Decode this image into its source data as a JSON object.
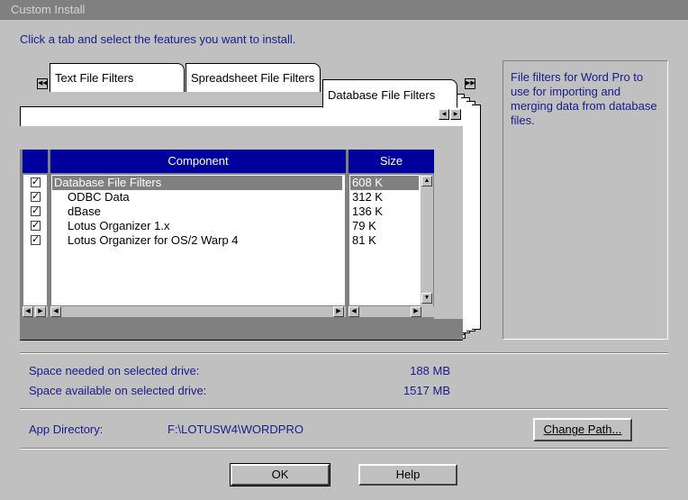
{
  "window": {
    "title": "Custom Install"
  },
  "instruction": "Click a tab and select the features you want to install.",
  "tabs": [
    {
      "label": "Text File Filters",
      "active": false
    },
    {
      "label": "Spreadsheet File Filters",
      "active": false
    },
    {
      "label": "Database File Filters",
      "active": true
    }
  ],
  "table": {
    "headers": {
      "component": "Component",
      "size": "Size"
    },
    "rows": [
      {
        "component": "Database File Filters",
        "size": "608 K",
        "checked": true,
        "selected": true
      },
      {
        "component": "ODBC Data",
        "size": "312 K",
        "checked": true,
        "selected": false
      },
      {
        "component": "dBase",
        "size": "136 K",
        "checked": true,
        "selected": false
      },
      {
        "component": "Lotus Organizer 1.x",
        "size": "79 K",
        "checked": true,
        "selected": false
      },
      {
        "component": "Lotus Organizer for OS/2 Warp 4",
        "size": "81 K",
        "checked": true,
        "selected": false
      }
    ]
  },
  "info": "File filters for Word Pro to use for importing and merging data from database files.",
  "space": {
    "needed_label": "Space needed on selected drive:",
    "needed_value": "188 MB",
    "available_label": "Space available on selected drive:",
    "available_value": "1517 MB"
  },
  "app_dir": {
    "label": "App Directory:",
    "value": "F:\\LOTUSW4\\WORDPRO",
    "change_label": "Change Path..."
  },
  "buttons": {
    "ok": "OK",
    "help": "Help"
  },
  "colors": {
    "header_bg": "#00009c",
    "text_blue": "#1a1a8c",
    "selection": "#808080"
  }
}
